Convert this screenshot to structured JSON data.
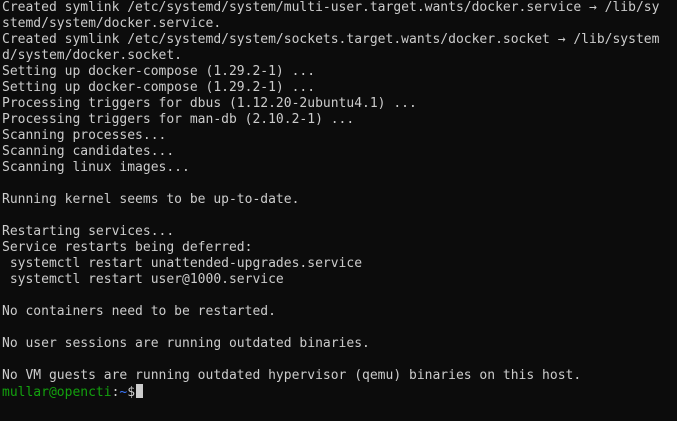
{
  "terminal": {
    "lines": [
      "Created symlink /etc/systemd/system/multi-user.target.wants/docker.service → /lib/sy",
      "stemd/system/docker.service.",
      "Created symlink /etc/systemd/system/sockets.target.wants/docker.socket → /lib/system",
      "d/system/docker.socket.",
      "Setting up docker-compose (1.29.2-1) ...",
      "Setting up docker-compose (1.29.2-1) ...",
      "Processing triggers for dbus (1.12.20-2ubuntu4.1) ...",
      "Processing triggers for man-db (2.10.2-1) ...",
      "Scanning processes...",
      "Scanning candidates...",
      "Scanning linux images...",
      "",
      "Running kernel seems to be up-to-date.",
      "",
      "Restarting services...",
      "Service restarts being deferred:",
      " systemctl restart unattended-upgrades.service",
      " systemctl restart user@1000.service",
      "",
      "No containers need to be restarted.",
      "",
      "No user sessions are running outdated binaries.",
      "",
      "No VM guests are running outdated hypervisor (qemu) binaries on this host."
    ],
    "prompt": {
      "user_host": "mullar@opencti",
      "separator": ":",
      "path": "~",
      "symbol": "$"
    }
  },
  "colors": {
    "background": "#0c0c0c",
    "foreground": "#cccccc",
    "prompt_user": "#13a10e",
    "prompt_path": "#3b78ff"
  }
}
